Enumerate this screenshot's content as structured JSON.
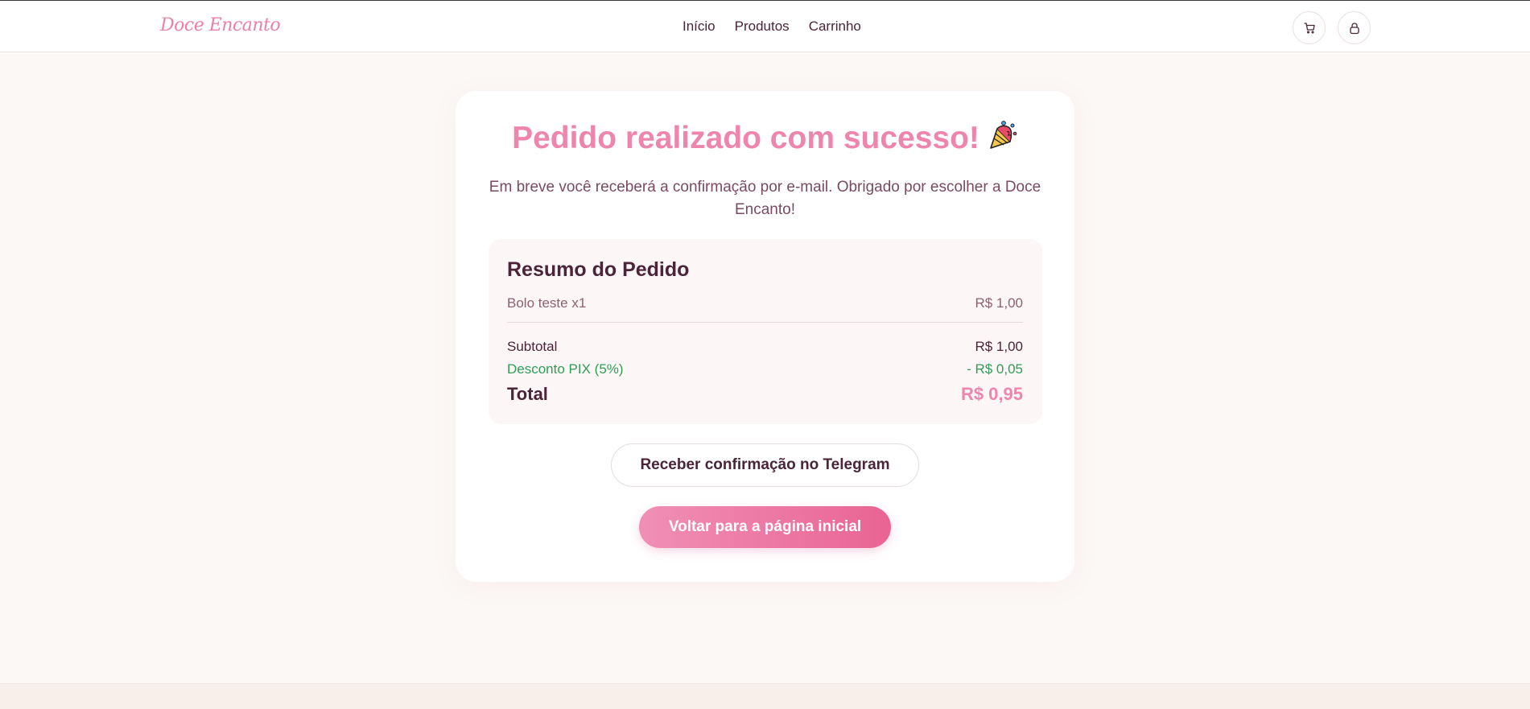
{
  "header": {
    "logo": "Doce Encanto",
    "nav": [
      {
        "label": "Início"
      },
      {
        "label": "Produtos"
      },
      {
        "label": "Carrinho"
      }
    ],
    "icons": [
      "cart-icon",
      "user-icon"
    ]
  },
  "confirmation": {
    "title": "Pedido realizado com sucesso!",
    "title_emoji": "party-popper",
    "message": "Em breve você receberá a confirmação por e-mail. Obrigado por escolher a Doce Encanto!"
  },
  "summary": {
    "title": "Resumo do Pedido",
    "items": [
      {
        "name": "Bolo teste x1",
        "price": "R$ 1,00"
      }
    ],
    "subtotal_label": "Subtotal",
    "subtotal_value": "R$ 1,00",
    "discount_label": "Desconto PIX (5%)",
    "discount_value": "- R$ 0,05",
    "total_label": "Total",
    "total_value": "R$ 0,95"
  },
  "actions": {
    "telegram_label": "Receber confirmação no Telegram",
    "home_label": "Voltar para a página inicial"
  },
  "colors": {
    "brand_pink": "#ee85ad",
    "text_dark": "#4a2438",
    "discount_green": "#2e9e55",
    "background": "#fbf8f6"
  }
}
